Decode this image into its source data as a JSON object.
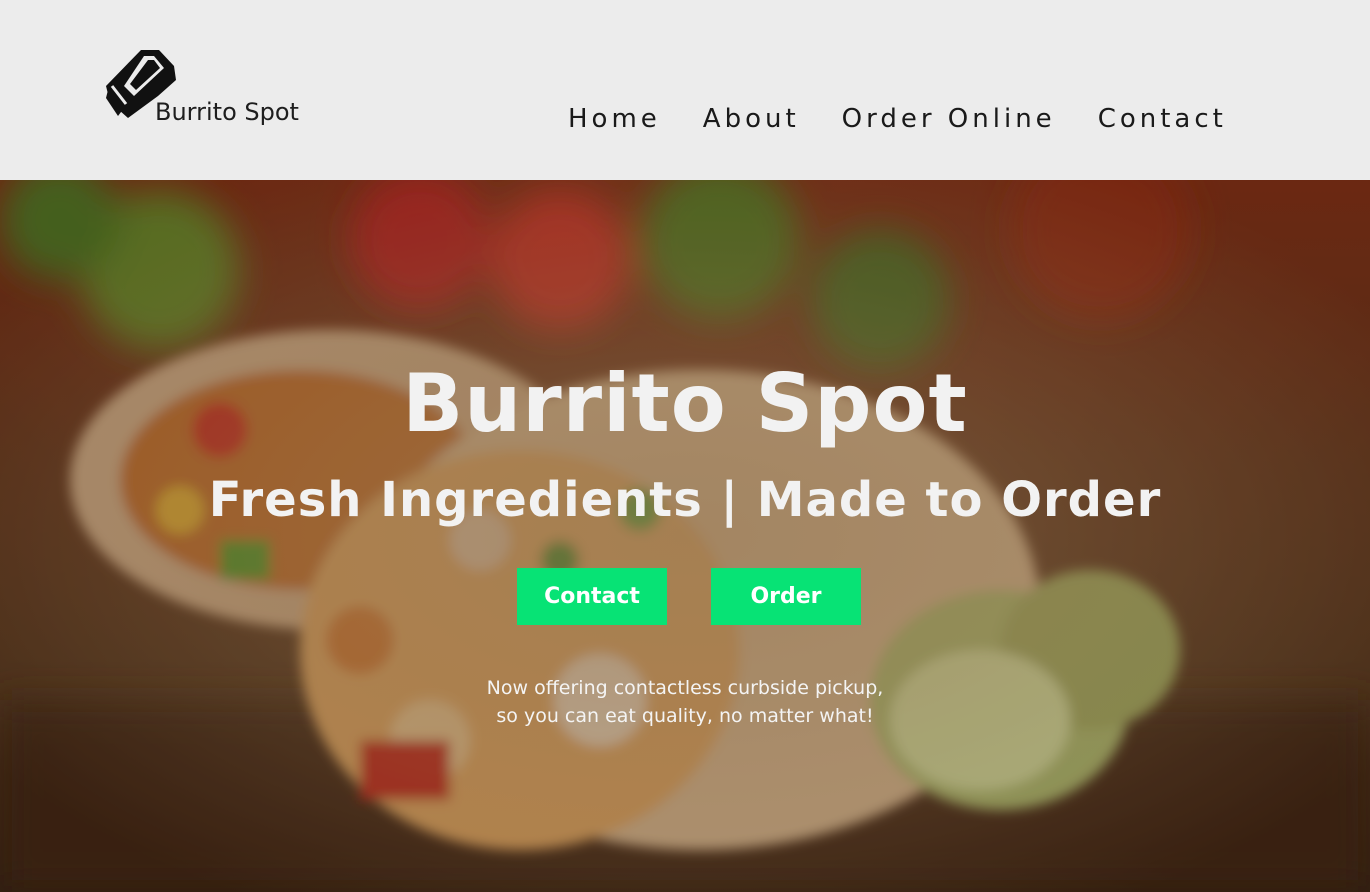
{
  "header": {
    "logo_text": "Burrito Spot",
    "nav": [
      "Home",
      "About",
      "Order Online",
      "Contact"
    ]
  },
  "hero": {
    "title": "Burrito Spot",
    "subtitle": "Fresh Ingredients | Made to Order",
    "buttons": {
      "contact": "Contact",
      "order": "Order"
    },
    "note_line1": "Now offering contactless curbside pickup,",
    "note_line2": "so you can eat quality, no matter what!"
  },
  "colors": {
    "header_bg": "#ececec",
    "button_bg": "#07e375",
    "text_light": "#f2f2f2"
  },
  "icons": [
    "burrito-logo-icon"
  ]
}
